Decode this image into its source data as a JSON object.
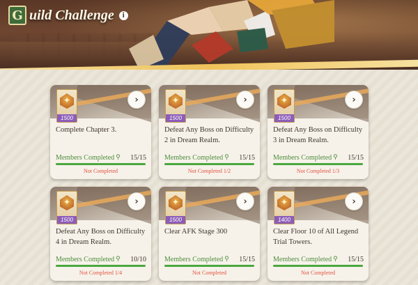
{
  "header": {
    "title_initial": "G",
    "title_rest": "uild Challenge",
    "info_icon": "i"
  },
  "challenges": [
    {
      "desc": "Complete Chapter 3.",
      "reward": "1500",
      "members_label": "Members Completed",
      "count": "15/15",
      "progress": 1.0,
      "status": "Not Completed"
    },
    {
      "desc": "Defeat Any Boss on Difficulty 2 in Dream Realm.",
      "reward": "1500",
      "members_label": "Members Completed",
      "count": "15/15",
      "progress": 1.0,
      "status": "Not Completed 1/2"
    },
    {
      "desc": "Defeat Any Boss on Difficulty 3 in Dream Realm.",
      "reward": "1500",
      "members_label": "Members Completed",
      "count": "15/15",
      "progress": 1.0,
      "status": "Not Completed 1/3"
    },
    {
      "desc": "Defeat Any Boss on Difficulty 4 in Dream Realm.",
      "reward": "1500",
      "members_label": "Members Completed",
      "count": "10/10",
      "progress": 1.0,
      "status": "Not Completed 1/4"
    },
    {
      "desc": "Clear AFK Stage 300",
      "reward": "1500",
      "members_label": "Members Completed",
      "count": "15/15",
      "progress": 1.0,
      "status": "Not Completed"
    },
    {
      "desc": "Clear Floor 10 of All Legend Trial Towers.",
      "reward": "1400",
      "members_label": "Members Completed",
      "count": "15/15",
      "progress": 1.0,
      "status": "Not Completed"
    }
  ],
  "icons": {
    "go": "chevron-right-icon",
    "members": "magnifier-icon",
    "reward": "guild-medal-icon"
  },
  "colors": {
    "accent_green": "#4e8d3c",
    "bar_green": "#4aa83e",
    "status_red": "#e0523e",
    "reward_purple": "#8c5db8"
  }
}
